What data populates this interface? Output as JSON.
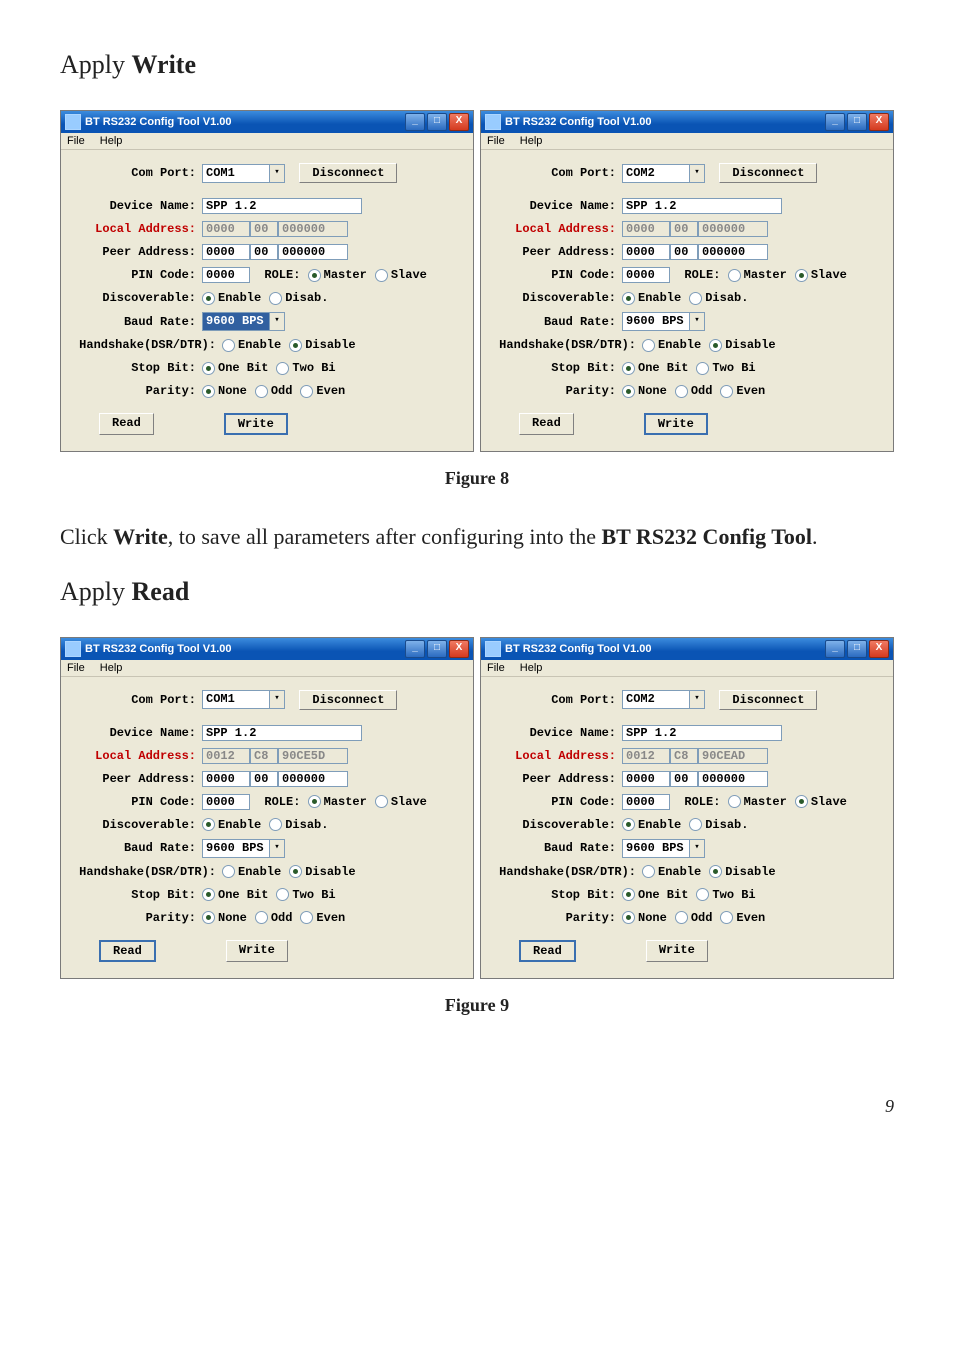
{
  "section1_title_pre": "Apply ",
  "section1_title_bold": "Write",
  "section2_title_pre": "Apply ",
  "section2_title_bold": "Read",
  "figure8_caption": "Figure 8",
  "figure9_caption": "Figure 9",
  "para_click": "Click ",
  "para_write": "Write",
  "para_mid": ", to save all parameters after configuring into the ",
  "para_tool": "BT RS232 Config Tool",
  "para_end": ".",
  "page_num": "9",
  "win_title": "BT RS232 Config Tool V1.00",
  "menu_file": "File",
  "menu_help": "Help",
  "lbl_com_port": "Com Port:",
  "btn_disconnect": "Disconnect",
  "lbl_device_name": "Device Name:",
  "device_name_val": "SPP 1.2",
  "lbl_local_addr": "Local Address:",
  "lbl_peer_addr": "Peer Address:",
  "lbl_pin": "PIN Code:",
  "pin_val": "0000",
  "lbl_role": "ROLE:",
  "role_master": "Master",
  "role_slave": "Slave",
  "lbl_discoverable": "Discoverable:",
  "disc_enable": "Enable",
  "disc_disable": "Disab.",
  "lbl_baud": "Baud Rate:",
  "baud_val": "9600 BPS",
  "lbl_handshake": "Handshake(DSR/DTR):",
  "hs_enable": "Enable",
  "hs_disable": "Disable",
  "lbl_stopbit": "Stop Bit:",
  "sb_one": "One Bit",
  "sb_two": "Two Bi",
  "lbl_parity": "Parity:",
  "par_none": "None",
  "par_odd": "Odd",
  "par_even": "Even",
  "btn_read": "Read",
  "btn_write": "Write",
  "com1": "COM1",
  "com2": "COM2",
  "la_a_dis": "0000",
  "la_b_dis": "00",
  "la_c_dis": "000000",
  "la_a_en": "0012",
  "la_b_en": "C8",
  "la_c_en1": "90CE5D",
  "la_c_en2": "90CEAD",
  "pa_a": "0000",
  "pa_b": "00",
  "pa_c": "000000"
}
